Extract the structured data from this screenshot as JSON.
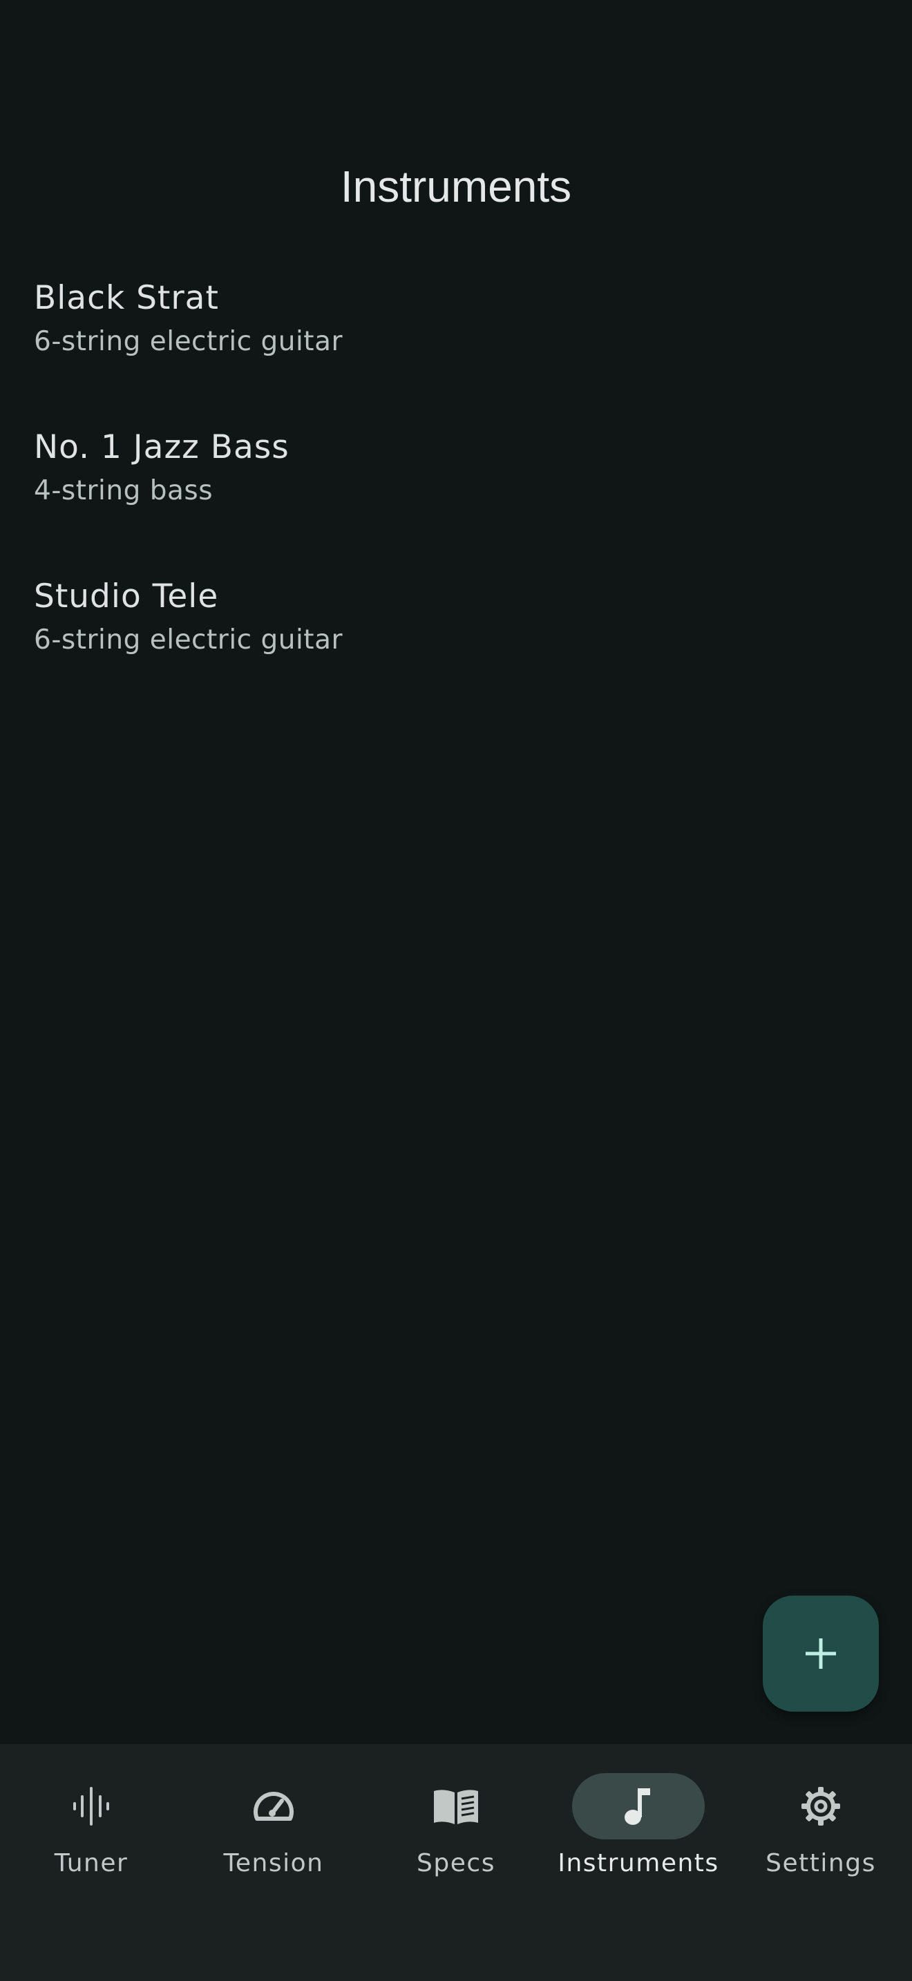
{
  "header": {
    "title": "Instruments"
  },
  "instruments": [
    {
      "name": "Black Strat",
      "type": "6-string electric guitar"
    },
    {
      "name": "No. 1 Jazz Bass",
      "type": "4-string bass"
    },
    {
      "name": "Studio Tele",
      "type": "6-string electric guitar"
    }
  ],
  "fab": {
    "icon": "plus-icon"
  },
  "nav": {
    "items": [
      {
        "label": "Tuner",
        "icon": "waveform-icon",
        "active": false
      },
      {
        "label": "Tension",
        "icon": "gauge-icon",
        "active": false
      },
      {
        "label": "Specs",
        "icon": "book-icon",
        "active": false
      },
      {
        "label": "Instruments",
        "icon": "music-note-icon",
        "active": true
      },
      {
        "label": "Settings",
        "icon": "gear-icon",
        "active": false
      }
    ]
  },
  "colors": {
    "background": "#101616",
    "nav_background": "#1b2020",
    "fab_background": "#214c47",
    "accent_icon": "#bfeee4",
    "active_pill": "#3a4a48"
  }
}
